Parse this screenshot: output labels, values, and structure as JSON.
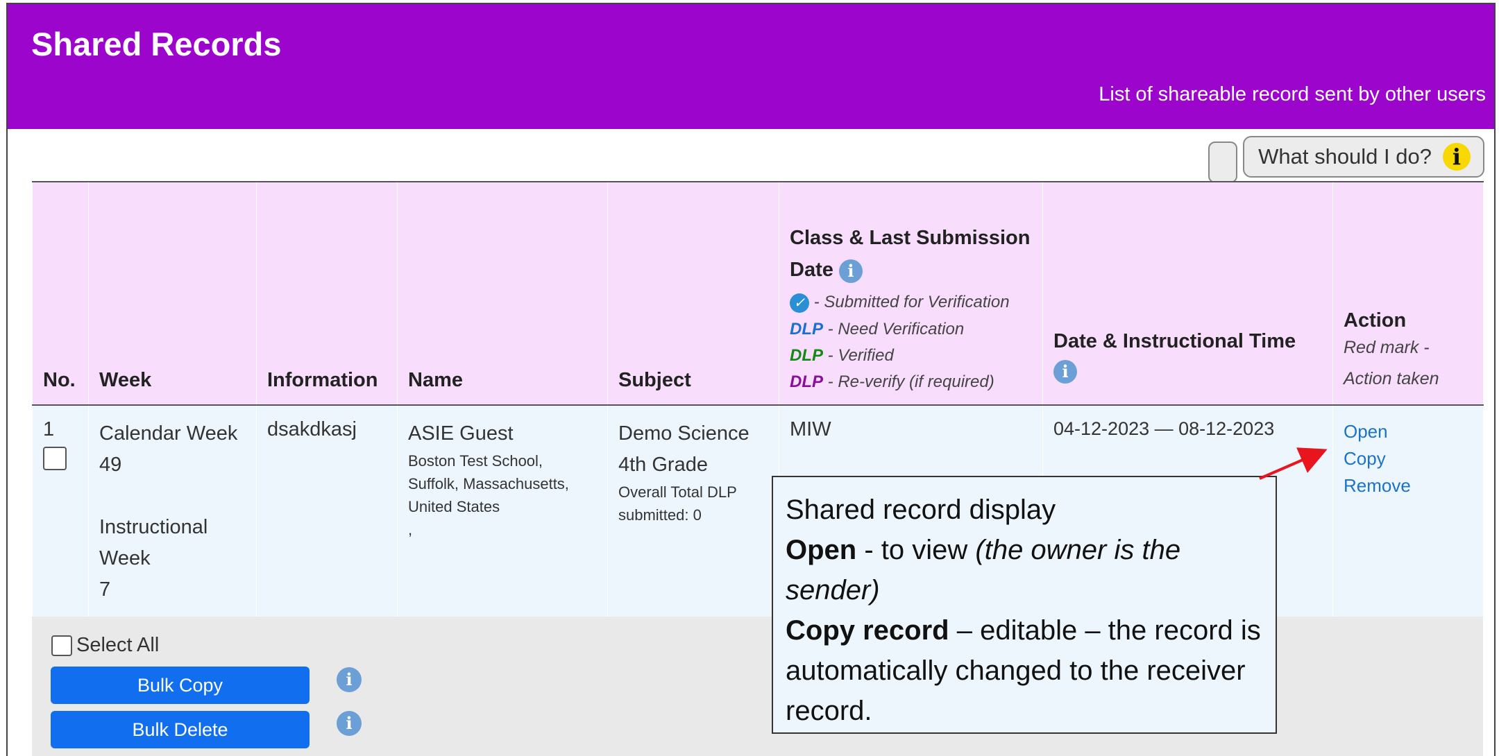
{
  "header": {
    "title": "Shared Records",
    "subtitle": "List of shareable record sent by other users"
  },
  "help": {
    "label": "What should I do?",
    "icon_glyph": "i"
  },
  "table": {
    "columns": {
      "no": "No.",
      "week": "Week",
      "information": "Information",
      "name": "Name",
      "subject": "Subject",
      "class_title": "Class & Last Submission Date",
      "date": "Date & Instructional Time",
      "action": "Action",
      "action_note": "Red mark - Action taken"
    },
    "legend": [
      {
        "mark": "",
        "text": "- Submitted for Verification"
      },
      {
        "mark": "DLP",
        "color": "#1a6fd0",
        "text": "- Need Verification"
      },
      {
        "mark": "DLP",
        "color": "#138a15",
        "text": "- Verified"
      },
      {
        "mark": "DLP",
        "color": "#8b0d9c",
        "text": "- Re-verify (if required)"
      }
    ],
    "row": {
      "no": "1",
      "week_calendar": "Calendar Week",
      "week_calendar_num": "49",
      "week_instructional": "Instructional Week",
      "week_instructional_num": "7",
      "information": "dsakdkasj",
      "name": "ASIE Guest",
      "address": "Boston Test School, Suffolk, Massachusetts, United States",
      "address_extra": ",",
      "subject": "Demo Science 4th Grade",
      "subject_note": "Overall Total DLP submitted: 0",
      "class": "MIW",
      "date": "04-12-2023 — 08-12-2023",
      "actions": [
        "Open",
        "Copy",
        "Remove"
      ]
    }
  },
  "footer": {
    "select_all": "Select All",
    "bulk_copy": "Bulk Copy",
    "bulk_delete": "Bulk Delete"
  },
  "callout": {
    "line1": "Shared record display",
    "open_bold": "Open",
    "open_text": " - to view ",
    "open_italic": "(the owner is the sender)",
    "copy_bold": "Copy record",
    "copy_text": " – editable – the record is automatically changed to the receiver record."
  },
  "colors": {
    "header_bg": "#9c06cc",
    "table_header_bg": "#f8ddfc",
    "row_bg": "#eef6fd",
    "button_blue": "#106eef",
    "arrow_red": "#e8141e"
  }
}
